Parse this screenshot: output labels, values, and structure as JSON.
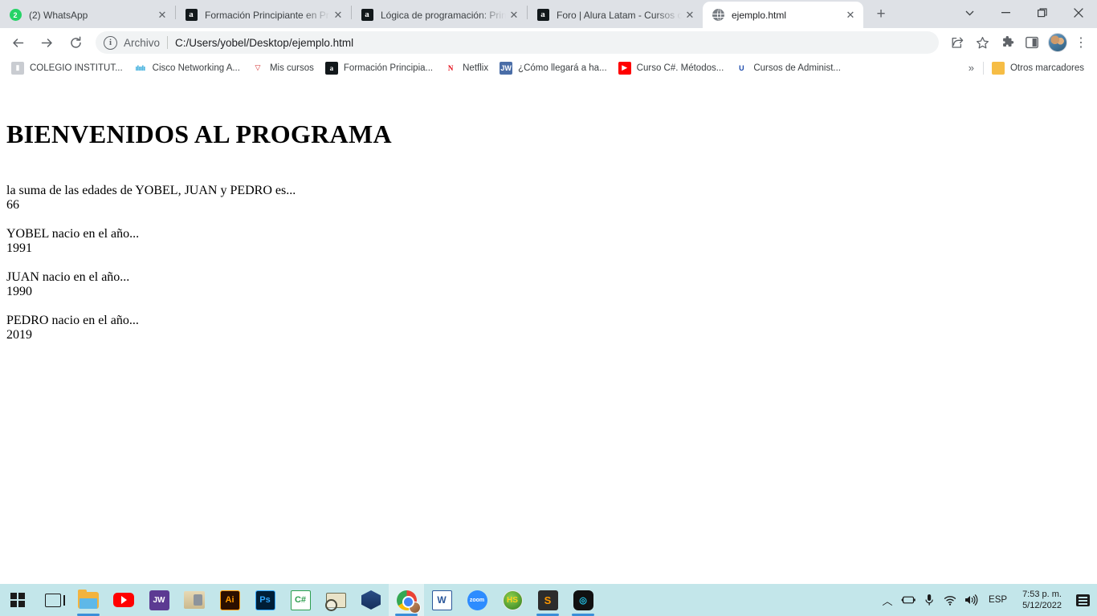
{
  "browser": {
    "tabs": [
      {
        "title": "(2) WhatsApp",
        "favicon": "whatsapp-icon",
        "active": false
      },
      {
        "title": "Formación Principiante en Pr",
        "favicon": "alura-icon",
        "active": false
      },
      {
        "title": "Lógica de programación: Prin",
        "favicon": "alura-icon",
        "active": false
      },
      {
        "title": "Foro | Alura Latam - Cursos o",
        "favicon": "alura-icon",
        "active": false
      },
      {
        "title": "ejemplo.html",
        "favicon": "globe-icon",
        "active": true
      }
    ],
    "new_tab_label": "+",
    "window_controls": {
      "list": "⌄",
      "minimize": "—",
      "maximize": "❐",
      "close": "✕"
    },
    "toolbar": {
      "back": "←",
      "forward": "→",
      "reload": "⟳",
      "info_icon": "i",
      "scheme_label": "Archivo",
      "url": "C:/Users/yobel/Desktop/ejemplo.html",
      "share_icon": "share-icon",
      "bookmark_icon": "star-icon",
      "extensions_icon": "puzzle-icon",
      "sidepanel_icon": "side-panel-icon",
      "profile_icon": "avatar",
      "menu_icon": "⋮"
    },
    "bookmarks": {
      "items": [
        {
          "label": "COLEGIO INSTITUT...",
          "icon": "colegio-icon"
        },
        {
          "label": "Cisco Networking A...",
          "icon": "cisco-icon"
        },
        {
          "label": "Mis cursos",
          "icon": "moodle-icon"
        },
        {
          "label": "Formación Principia...",
          "icon": "alura-icon"
        },
        {
          "label": "Netflix",
          "icon": "netflix-icon"
        },
        {
          "label": "¿Cómo llegará a ha...",
          "icon": "jw-icon"
        },
        {
          "label": "Curso C#. Métodos...",
          "icon": "youtube-icon"
        },
        {
          "label": "Cursos de Administ...",
          "icon": "udemy-icon"
        }
      ],
      "overflow_label": "»",
      "other_bookmarks_label": "Otros marcadores"
    }
  },
  "page": {
    "heading": "BIENVENIDOS AL PROGRAMA",
    "blocks": [
      {
        "label": "la suma de las edades de YOBEL, JUAN y PEDRO es...",
        "value": "66"
      },
      {
        "label": "YOBEL nacio en el año...",
        "value": "1991"
      },
      {
        "label": "JUAN nacio en el año...",
        "value": "1990"
      },
      {
        "label": "PEDRO nacio en el año...",
        "value": "2019"
      }
    ]
  },
  "taskbar": {
    "apps": [
      {
        "name": "start-button",
        "icon": "windows-logo-icon",
        "running": false,
        "active": false
      },
      {
        "name": "task-view-button",
        "icon": "task-view-icon",
        "running": false,
        "active": false
      },
      {
        "name": "file-explorer",
        "icon": "folder-icon",
        "running": true,
        "active": false
      },
      {
        "name": "youtube",
        "icon": "youtube-icon",
        "running": false,
        "active": false
      },
      {
        "name": "jw-library",
        "icon": "jw-icon",
        "label": "JW",
        "running": false,
        "active": false
      },
      {
        "name": "biblioteca",
        "icon": "library-icon",
        "running": false,
        "active": false
      },
      {
        "name": "illustrator",
        "icon": "illustrator-icon",
        "label": "Ai",
        "running": false,
        "active": false
      },
      {
        "name": "photoshop",
        "icon": "photoshop-icon",
        "label": "Ps",
        "running": false,
        "active": false
      },
      {
        "name": "visual-csharp",
        "icon": "csharp-icon",
        "label": "C#",
        "running": false,
        "active": false
      },
      {
        "name": "mail-search",
        "icon": "mail-icon",
        "running": false,
        "active": false
      },
      {
        "name": "virtualbox",
        "icon": "virtualbox-icon",
        "running": false,
        "active": false
      },
      {
        "name": "google-chrome",
        "icon": "chrome-icon",
        "running": true,
        "active": true
      },
      {
        "name": "microsoft-word",
        "icon": "word-icon",
        "label": "W",
        "running": false,
        "active": false
      },
      {
        "name": "zoom",
        "icon": "zoom-icon",
        "label": "zoom",
        "running": false,
        "active": false
      },
      {
        "name": "hotspot-shield",
        "icon": "hs-icon",
        "label": "HS",
        "running": false,
        "active": false
      },
      {
        "name": "sublime-text",
        "icon": "sublime-icon",
        "label": "S",
        "running": true,
        "active": false
      },
      {
        "name": "opera-gx",
        "icon": "opera-icon",
        "running": true,
        "active": false
      }
    ],
    "tray": {
      "chevron": "︿",
      "battery_icon": "battery-icon",
      "mic_icon": "microphone-icon",
      "wifi_icon": "wifi-icon",
      "volume_icon": "volume-icon",
      "language": "ESP",
      "time": "7:53 p. m.",
      "date": "5/12/2022",
      "notification_icon": "notification-icon"
    }
  },
  "colors": {
    "tabstrip_bg": "#dee1e6",
    "toolbar_bg": "#ffffff",
    "omnibox_bg": "#f1f3f4",
    "taskbar_bg": "#c3e6ea",
    "accent_blue": "#3a8fd8",
    "page_bg": "#ffffff",
    "text": "#202124"
  }
}
